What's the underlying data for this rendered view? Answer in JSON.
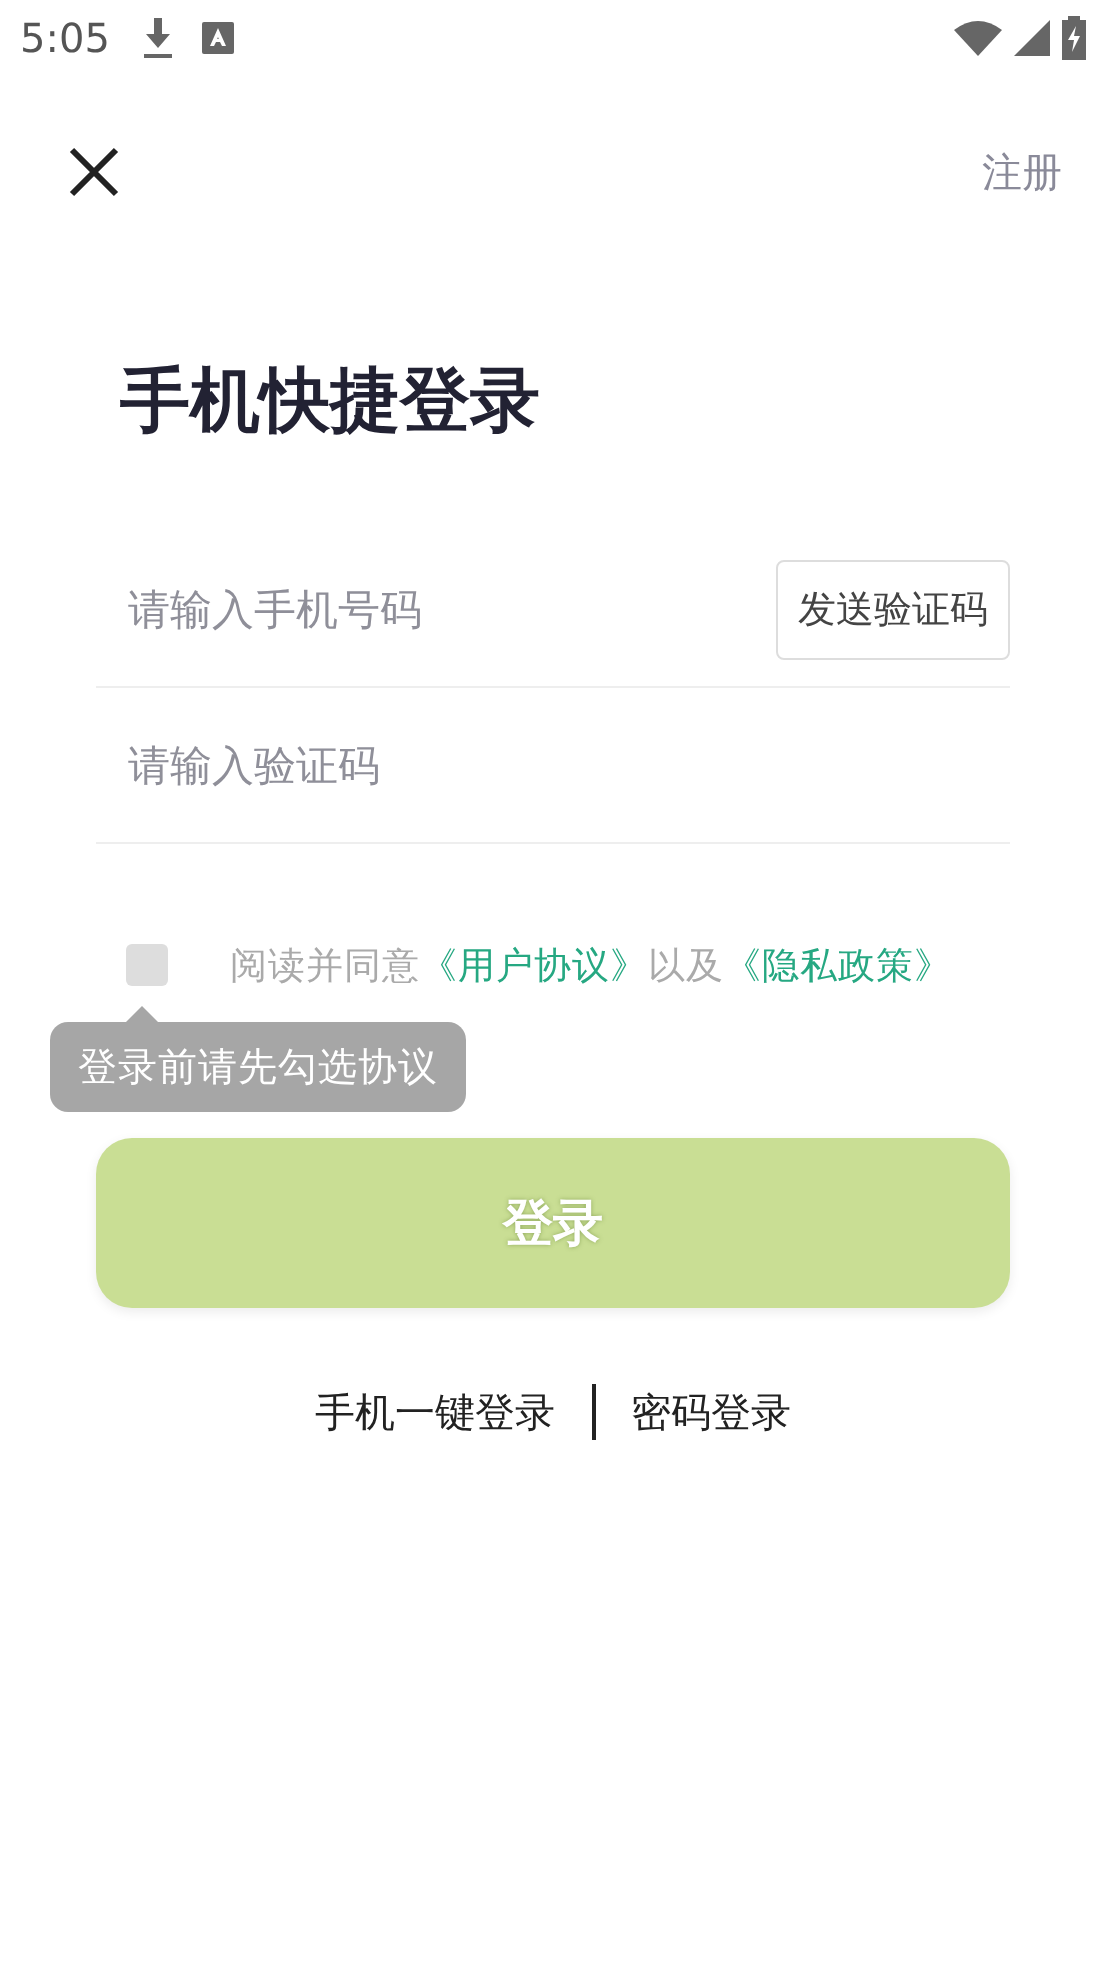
{
  "status_bar": {
    "time": "5:05"
  },
  "nav": {
    "action": "注册"
  },
  "title": "手机快捷登录",
  "fields": [
    {
      "placeholder": "请输入手机号码",
      "button": "发送验证码"
    },
    {
      "placeholder": "请输入验证码"
    }
  ],
  "agreement": {
    "checked": false,
    "parts": [
      {
        "kind": "text",
        "text": "阅读并同意"
      },
      {
        "kind": "link",
        "text": "《用户协议》"
      },
      {
        "kind": "text",
        "text": "以及"
      },
      {
        "kind": "link",
        "text": "《隐私政策》"
      }
    ]
  },
  "tooltip": "登录前请先勾选协议",
  "login_button": {
    "label": "登录",
    "disabled": true
  },
  "alt_logins": [
    "手机一键登录",
    "密码登录"
  ]
}
